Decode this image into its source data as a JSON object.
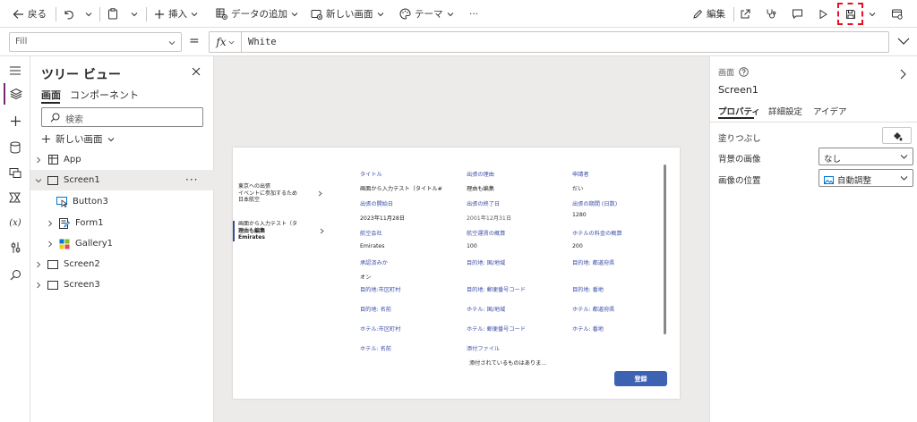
{
  "toolbar": {
    "back": "戻る",
    "insert": "挿入",
    "add_data": "データの追加",
    "new_screen": "新しい画面",
    "theme": "テーマ",
    "more": "···",
    "edit": "編集"
  },
  "formula_bar": {
    "property": "Fill",
    "equals": "=",
    "fx": "fx",
    "formula": "White"
  },
  "tree": {
    "title": "ツリー ビュー",
    "tabs": [
      "画面",
      "コンポーネント"
    ],
    "search_placeholder": "検索",
    "new_screen": "新しい画面",
    "items": [
      {
        "label": "App"
      },
      {
        "label": "Screen1"
      },
      {
        "label": "Button3"
      },
      {
        "label": "Form1"
      },
      {
        "label": "Gallery1"
      },
      {
        "label": "Screen2"
      },
      {
        "label": "Screen3"
      }
    ],
    "more": "···"
  },
  "app_screen": {
    "gallery": [
      {
        "title": "東京への出張",
        "subtitle": "イベントに参加するため",
        "body": "日本航空"
      },
      {
        "title": "画面から入力テスト（タ",
        "subtitle": "理由も編集",
        "body": "Emirates"
      }
    ],
    "fields": [
      {
        "label": "タイトル",
        "value": "画面から入力テスト（タイトル#"
      },
      {
        "label": "出張の理由",
        "value": "理由も編集"
      },
      {
        "label": "申請者",
        "value": "だい"
      },
      {
        "label": "出張の開始日",
        "value": "2023年11月28日"
      },
      {
        "label": "出張の終了日",
        "value": "2001年12月31日"
      },
      {
        "label": "出張の期間 (日数)",
        "value": "1280"
      },
      {
        "label": "航空会社",
        "value": "Emirates"
      },
      {
        "label": "航空運賃の概算",
        "value": "100"
      },
      {
        "label": "ホテルの料金の概算",
        "value": "200"
      },
      {
        "label": "承認済みか",
        "value": "オン"
      },
      {
        "label": "目的地: 国/地域",
        "value": ""
      },
      {
        "label": "目的地: 都道府県",
        "value": ""
      },
      {
        "label": "目的地:市区町村",
        "value": ""
      },
      {
        "label": "目的地: 郵便番号コード",
        "value": ""
      },
      {
        "label": "目的地: 番地",
        "value": ""
      },
      {
        "label": "目的地: 名前",
        "value": ""
      },
      {
        "label": "ホテル: 国/地域",
        "value": ""
      },
      {
        "label": "ホテル: 都道府県",
        "value": ""
      },
      {
        "label": "ホテル:市区町村",
        "value": ""
      },
      {
        "label": "ホテル: 郵便番号コード",
        "value": ""
      },
      {
        "label": "ホテル: 番地",
        "value": ""
      },
      {
        "label": "ホテル: 名前",
        "value": ""
      },
      {
        "label": "添付ファイル",
        "value": "添付されているものはありま..."
      }
    ],
    "submit_label": "登録"
  },
  "properties": {
    "type_label": "画面",
    "name": "Screen1",
    "tabs": [
      "プロパティ",
      "詳細設定",
      "アイデア"
    ],
    "fill_label": "塗りつぶし",
    "bg_image_label": "背景の画像",
    "bg_image_value": "なし",
    "image_position_label": "画像の位置",
    "image_position_value": "自動調整"
  },
  "colors": {
    "accent": "#742774",
    "save_highlight": "#e81123",
    "form_label": "#3d4fa8",
    "submit_button": "#3d62b3"
  }
}
